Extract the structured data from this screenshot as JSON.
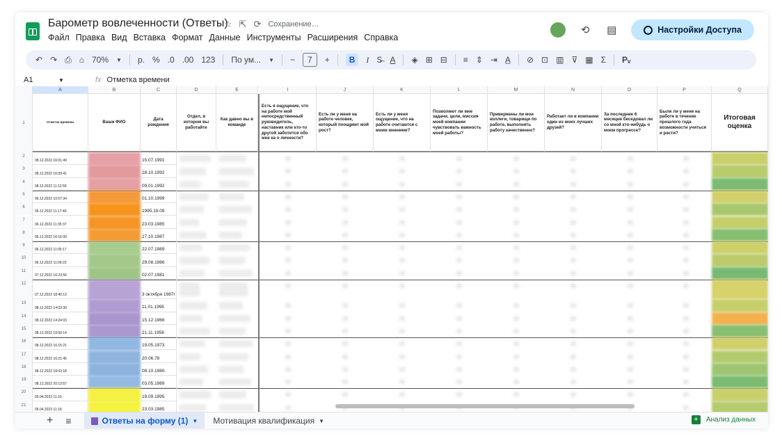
{
  "title": {
    "doc_name": "Барометр вовлеченности (Ответы)",
    "status": "Сохранение…",
    "icons": [
      "star-icon",
      "move-icon",
      "sync-icon"
    ]
  },
  "menu": [
    "Файл",
    "Правка",
    "Вид",
    "Вставка",
    "Формат",
    "Данные",
    "Инструменты",
    "Расширения",
    "Справка"
  ],
  "top_right": {
    "share_label": "Настройки Доступа"
  },
  "toolbar": {
    "zoom": "70%",
    "currency": "р.",
    "percent": "%",
    "dec_less": ".0",
    "dec_more": ".00",
    "number_format": "123",
    "font": "По ум...",
    "font_size": "7",
    "bold": "B",
    "italic": "I"
  },
  "formula_bar": {
    "cell_ref": "A1",
    "fx": "fx",
    "content": "Отметка времени"
  },
  "columns": [
    "A",
    "B",
    "C",
    "D",
    "E",
    "I",
    "J",
    "K",
    "L",
    "M",
    "N",
    "O",
    "P",
    "Q"
  ],
  "headers": {
    "a": "Отметка времени",
    "b": "Ваши ФИО",
    "c": "Дата рождения",
    "d": "Отдел, в котором вы работайте",
    "e": "Как давно вы в команде",
    "i": "Есть я ощущение, что на работе мой непосредственный руководитель, наставник или кто-то другой заботится обо мне ка о личности?",
    "j": "Есть ли у меня на работе человек, который поощряет мой рост?",
    "k": "Есть ли у меня ощущение, что на работе считаются с моим мнением?",
    "l": "Позволяют ли мне задачи, цели, миссия моей компании чувствовать важность моей работы?",
    "m": "Привержены ли мои коллеги, товарищи по работе, выполнять работу качественно?",
    "n": "Работает ли в компании один из моих лучших друзей?",
    "o": "За последние 6 месяцев беседовал ли со мной кто-нибудь о моем прогрессе?",
    "p": "Были ли у меня на работе в течение прошлого года возможности учиться и расти?",
    "q": "Итоговая оценка"
  },
  "rows": [
    {
      "n": "2",
      "ts": "08.12.2022 16:01:49",
      "dob": "15.07.1991",
      "fio_color": "#e5a1a6",
      "score_color": "#c9d06a"
    },
    {
      "n": "3",
      "ts": "08.12.2022 16:09:41",
      "dob": "28.10.1992",
      "fio_color": "#e39a9d",
      "score_color": "#b8cc6e"
    },
    {
      "n": "4",
      "ts": "08.12.2022 11:12:59",
      "dob": "09.01.1992",
      "fio_color": "#e4a0a2",
      "score_color": "#7dbb72"
    },
    {
      "n": "5",
      "ts": "06.12.2022 10:57:34",
      "dob": "01.10.1999",
      "fio_color": "#f59a3a",
      "score_color": "#d3cf6a"
    },
    {
      "n": "6",
      "ts": "06.12.2022 11:17:40",
      "dob": "1995.19.09",
      "fio_color": "#f7941d",
      "score_color": "#a9c86e"
    },
    {
      "n": "7",
      "ts": "06.12.2022 11:35:37",
      "dob": "23.03.1985",
      "fio_color": "#f69525",
      "score_color": "#c5cf6a"
    },
    {
      "n": "8",
      "ts": "06.12.2022 16:16:00",
      "dob": "27.10.1987",
      "fio_color": "#f59b33",
      "score_color": "#86bf70"
    },
    {
      "n": "9",
      "ts": "06.12.2022 11:05:17",
      "dob": "22.07.1989",
      "fio_color": "#a8cc8e",
      "score_color": "#cfd06a"
    },
    {
      "n": "10",
      "ts": "06.12.2022 11:09:23",
      "dob": "29.08.1986",
      "fio_color": "#a3c88a",
      "score_color": "#bccc6d"
    },
    {
      "n": "11",
      "ts": "07.12.2022 16:23:56",
      "dob": "02.07.1981",
      "fio_color": "#9fc586",
      "score_color": "#78ba72"
    },
    {
      "n": "12",
      "ts": "07.12.2022 18:40:13",
      "dob": "3 октября 1987г",
      "fio_color": "#b7a3d6",
      "score_color": "#d7d26a"
    },
    {
      "n": "13",
      "ts": "08.12.2022 14:03:30",
      "dob": "11.01.1995",
      "fio_color": "#b09cd2",
      "score_color": "#c7cf6b"
    },
    {
      "n": "14",
      "ts": "08.12.2022 14:24:03",
      "dob": "15.12.1966",
      "fio_color": "#a896cc",
      "score_color": "#f3b24e"
    },
    {
      "n": "15",
      "ts": "08.12.2022 19:50:14",
      "dob": "21.11.1956",
      "fio_color": "#ab98cf",
      "score_color": "#89bf71"
    },
    {
      "n": "16",
      "ts": "08.12.2022 16:15:21",
      "dob": "19.05.1973",
      "fio_color": "#91b8e2",
      "score_color": "#d2d06a"
    },
    {
      "n": "17",
      "ts": "08.12.2022 16:21:45",
      "dob": "20.06.78",
      "fio_color": "#8fb5df",
      "score_color": "#b4cb6d"
    },
    {
      "n": "18",
      "ts": "08.12.2022 18:03:18",
      "dob": "08.10.1980.",
      "fio_color": "#8cb3de",
      "score_color": "#9ec56f"
    },
    {
      "n": "19",
      "ts": "08.12.2022 20:13:57",
      "dob": "03.05.1989",
      "fio_color": "#94bae3",
      "score_color": "#7cbb72"
    },
    {
      "n": "20",
      "ts": "05.04.2023 11:10:",
      "dob": "19.09.1995",
      "fio_color": "#f5f142",
      "score_color": "#c8cf6b"
    },
    {
      "n": "21",
      "ts": "05.04.2023 11:16:",
      "dob": "23.03.1985",
      "fio_color": "#f6f240",
      "score_color": "#b5cb6d"
    }
  ],
  "sheets": {
    "active": "Ответы на форму (1)",
    "other": "Мотивация квалификация",
    "explore": "Анализ данных"
  }
}
